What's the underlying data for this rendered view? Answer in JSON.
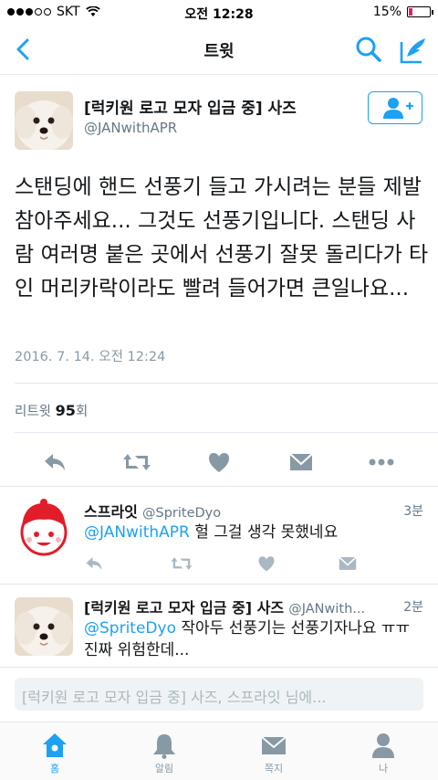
{
  "status_bar": {
    "carrier": "SKT",
    "time": "오전 12:28",
    "battery": "15%",
    "battery_level": 0.15
  },
  "nav": {
    "title": "트윗"
  },
  "tweet": {
    "display_name": "[럭키원 로고 모자 입금 중] 사즈",
    "handle": "@JANwithAPR",
    "text": "스탠딩에 핸드 선풍기 들고 가시려는 분들 제발 참아주세요... 그것도 선풍기입니다. 스탠딩 사람 여러명 붙은 곳에서 선풍기 잘못 돌리다가 타인 머리카락이라도 빨려 들어가면 큰일나요...",
    "date": "2016. 7. 14. 오전 12:24",
    "retweet_label": "리트윗",
    "retweet_count": "95",
    "retweet_suffix": "회"
  },
  "replies": [
    {
      "display_name": "스프라잇",
      "handle": "@SpriteDyo",
      "time": "3분",
      "mention": "@JANwithAPR",
      "text": " 헐 그걸 생각 못했네요"
    },
    {
      "display_name": "[럭키원 로고 모자 입금 중] 사즈",
      "handle": "@JANwith...",
      "time": "2분",
      "mention": "@SpriteDyo",
      "text": " 작아두 선풍기는 선풍기자나요 ㅠㅠ 진짜 위험한데..."
    }
  ],
  "reply_bar": {
    "placeholder": "[럭키원 로고 모자 입금 중] 사즈, 스프라잇 님에..."
  },
  "tabs": [
    {
      "label": "홈",
      "icon": "home-icon"
    },
    {
      "label": "알림",
      "icon": "bell-icon"
    },
    {
      "label": "쪽지",
      "icon": "envelope-icon"
    },
    {
      "label": "나",
      "icon": "person-icon"
    }
  ],
  "colors": {
    "accent": "#1da1f2",
    "icon_gray": "#8899a6",
    "battery_low": "#e0245e"
  }
}
